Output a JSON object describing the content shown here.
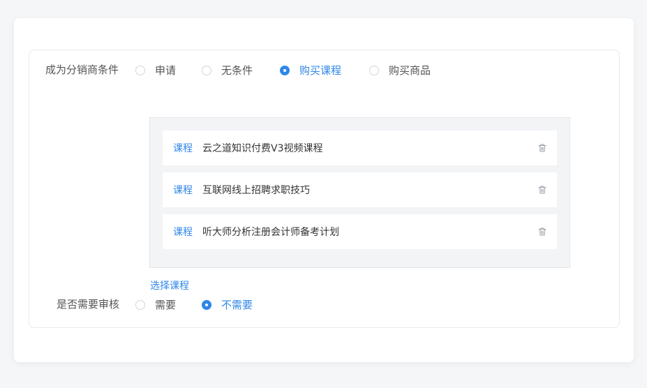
{
  "distributor": {
    "label": "成为分销商条件",
    "options": [
      {
        "label": "申请",
        "checked": false
      },
      {
        "label": "无条件",
        "checked": false
      },
      {
        "label": "购买课程",
        "checked": true
      },
      {
        "label": "购买商品",
        "checked": false
      }
    ]
  },
  "courses": [
    {
      "tag": "课程",
      "name": "云之道知识付费V3视频课程",
      "icon": "trash-icon"
    },
    {
      "tag": "课程",
      "name": "互联网线上招聘求职技巧",
      "icon": "trash-icon"
    },
    {
      "tag": "课程",
      "name": "听大师分析注册会计师备考计划",
      "icon": "trash-icon"
    }
  ],
  "select_course_label": "选择课程",
  "review": {
    "label": "是否需要审核",
    "options": [
      {
        "label": "需要",
        "checked": false
      },
      {
        "label": "不需要",
        "checked": true
      }
    ]
  },
  "colors": {
    "accent": "#2f86e8"
  }
}
